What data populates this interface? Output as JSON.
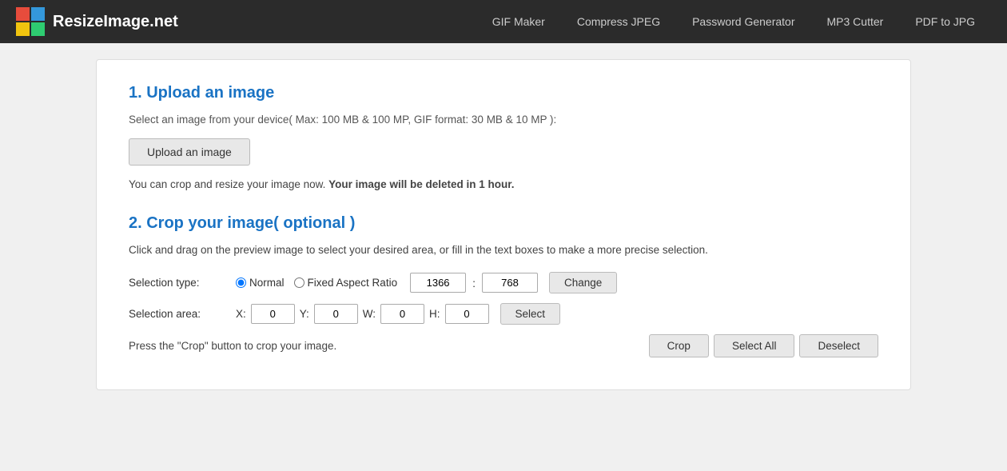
{
  "header": {
    "logo_text": "ResizeImage.net",
    "nav_items": [
      {
        "label": "GIF Maker",
        "id": "gif-maker"
      },
      {
        "label": "Compress JPEG",
        "id": "compress-jpeg"
      },
      {
        "label": "Password Generator",
        "id": "password-generator"
      },
      {
        "label": "MP3 Cutter",
        "id": "mp3-cutter"
      },
      {
        "label": "PDF to JPG",
        "id": "pdf-to-jpg"
      }
    ]
  },
  "section1": {
    "title": "1. Upload an image",
    "desc": "Select an image from your device( Max: 100 MB & 100 MP, GIF format: 30 MB & 10 MP ):",
    "upload_btn_label": "Upload an image",
    "info_text_normal": "You can crop and resize your image now.",
    "info_text_bold": "Your image will be deleted in 1 hour."
  },
  "section2": {
    "title": "2. Crop your image( optional )",
    "desc": "Click and drag on the preview image to select your desired area, or fill in the text boxes to make a more precise selection.",
    "selection_type_label": "Selection type:",
    "radio_normal_label": "Normal",
    "radio_fixed_label": "Fixed Aspect Ratio",
    "width_value": "1366",
    "height_value": "768",
    "change_btn_label": "Change",
    "selection_area_label": "Selection area:",
    "x_label": "X:",
    "x_value": "0",
    "y_label": "Y:",
    "y_value": "0",
    "w_label": "W:",
    "w_value": "0",
    "h_label": "H:",
    "h_value": "0",
    "select_btn_label": "Select",
    "crop_hint": "Press the \"Crop\" button to crop your image.",
    "crop_btn_label": "Crop",
    "select_all_btn_label": "Select All",
    "deselect_btn_label": "Deselect"
  }
}
